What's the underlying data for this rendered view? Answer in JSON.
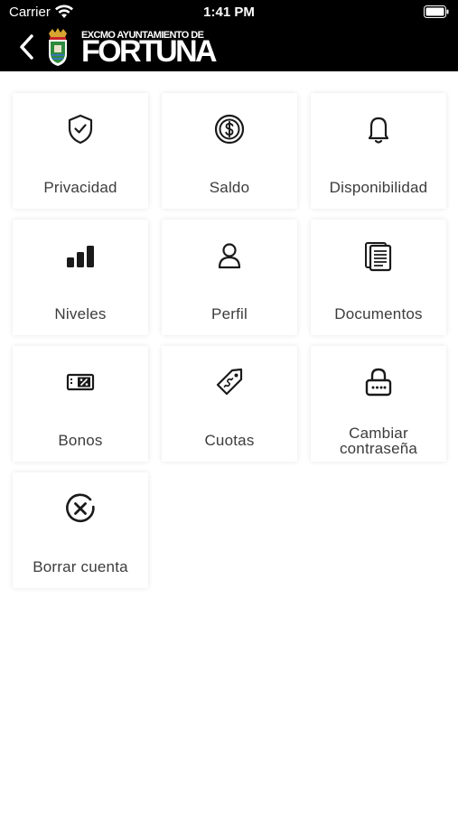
{
  "status_bar": {
    "carrier": "Carrier",
    "time": "1:41 PM"
  },
  "header": {
    "logo_small": "EXCMO AYUNTAMIENTO DE",
    "logo_big": "FORTUNA"
  },
  "menu": {
    "privacidad": "Privacidad",
    "saldo": "Saldo",
    "disponibilidad": "Disponibilidad",
    "niveles": "Niveles",
    "perfil": "Perfil",
    "documentos": "Documentos",
    "bonos": "Bonos",
    "cuotas": "Cuotas",
    "cambiar_line1": "Cambiar",
    "cambiar_line2": "contraseña",
    "borrar": "Borrar cuenta"
  },
  "icons": {
    "privacidad": "shield-check-icon",
    "saldo": "coin-dollar-icon",
    "disponibilidad": "bell-icon",
    "niveles": "bar-levels-icon",
    "perfil": "user-icon",
    "documentos": "documents-icon",
    "bonos": "discount-ticket-icon",
    "cuotas": "price-tag-icon",
    "cambiar": "lock-icon",
    "borrar": "close-circle-icon"
  }
}
